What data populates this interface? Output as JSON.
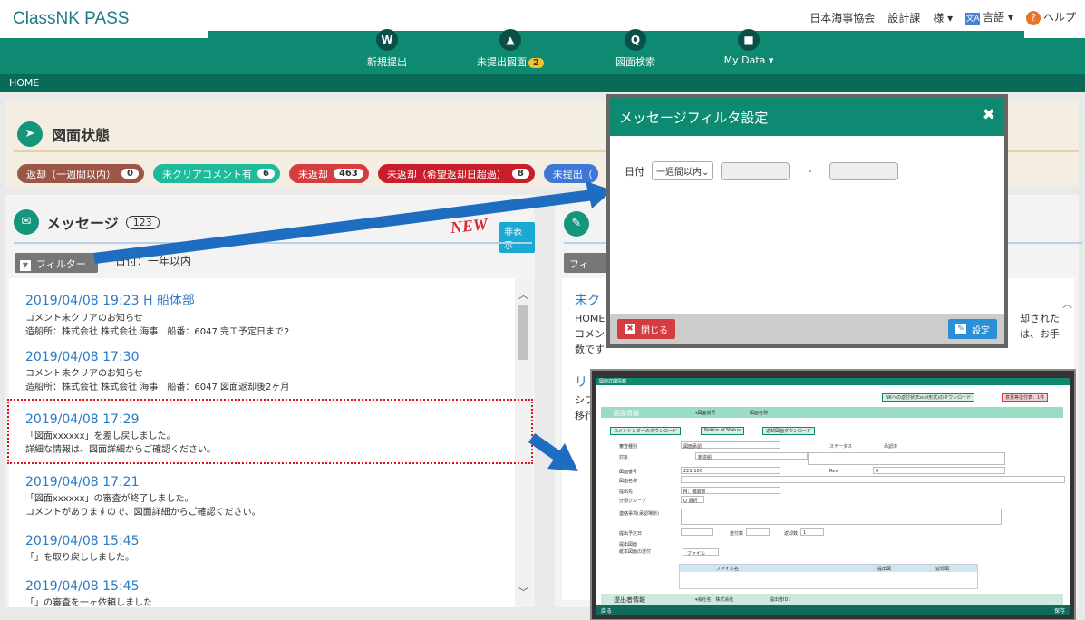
{
  "app": {
    "title": "ClassNK PASS"
  },
  "user_nav": {
    "org": "日本海事協会",
    "dept": "設計課",
    "honorific": "様 ▾",
    "lang": "言語 ▾",
    "lang_icon": "文A",
    "help": "ヘルプ",
    "help_icon": "?"
  },
  "nav": [
    {
      "label": "新規提出",
      "icon": "W"
    },
    {
      "label": "未提出図面",
      "badge": "2",
      "icon": "▲"
    },
    {
      "label": "図面検索",
      "icon": "Q"
    },
    {
      "label": "My Data ▾",
      "icon": "■"
    }
  ],
  "breadcrumb": "HOME",
  "status": {
    "title": "図面状態",
    "pills": [
      {
        "label": "返却（一週間以内）",
        "count": "0"
      },
      {
        "label": "未クリアコメント有",
        "count": "6"
      },
      {
        "label": "未返却",
        "count": "463"
      },
      {
        "label": "未返却（希望返却日超過）",
        "count": "8"
      },
      {
        "label": "未提出（",
        "count": ""
      }
    ]
  },
  "messages": {
    "title": "メッセージ",
    "count": "123",
    "new_badge": "NEW",
    "hide": "非表示",
    "filter": "フィルター",
    "filter_date": "日付：一年以内",
    "items": [
      {
        "date": "2019/04/08 19:23 H 船体部",
        "line1": "コメント未クリアのお知らせ",
        "line2": "造船所：株式会社 株式会社 海事　船番：6047 完工予定日まで2"
      },
      {
        "date": "2019/04/08 17:30",
        "line1": "コメント未クリアのお知らせ",
        "line2": "造船所：株式会社 株式会社 海事　船番：6047 図面返却後2ヶ月"
      },
      {
        "date": "2019/04/08 17:29",
        "line1": "「図面xxxxxx」を差し戻しました。",
        "line2": "詳細な情報は、図面詳細からご確認ください。"
      },
      {
        "date": "2019/04/08 17:21",
        "line1": "「図面xxxxxx」の審査が終了しました。",
        "line2": "コメントがありますので、図面詳細からご確認ください。"
      },
      {
        "date": "2019/04/08 15:45",
        "line1": "「」を取り戻ししました。",
        "line2": ""
      },
      {
        "date": "2019/04/08 15:45",
        "line1": "「」の審査を一ヶ依頼しました",
        "line2": ""
      }
    ]
  },
  "right": {
    "filter": "フィ",
    "t1": "未ク",
    "tx1a": "HOME",
    "tx1b": "コメン",
    "tx1c": "数です",
    "tx1r1": "却された",
    "tx1r2": "は、お手",
    "t2": "リ",
    "tx2a": "シフ",
    "tx2b": "移行"
  },
  "modal": {
    "title": "メッセージフィルタ設定",
    "close_icon": "✖",
    "date_label": "日付",
    "date_select": "一週間以内⌄",
    "dash": "-",
    "close_btn": "閉じる",
    "set_btn": "設定"
  },
  "thumb": {
    "title": "図面詳細情報",
    "dl1": "NKへの返付状(Excel形式)のダウンロード",
    "dl2": "意見等送付表：1件",
    "sec1": "図面情報",
    "drawing_no": "▾図面番号",
    "drawing_name": "図面名称",
    "btn1": "コメントレターのダウンロード",
    "btn2": "Notice of Status",
    "btn3": "返却図面ダウンロード",
    "l_kind": "審査種別",
    "v_kind": "図面承認",
    "l_status": "ステータス",
    "v_status": "承認済",
    "l_target": "対象",
    "v_target": "新造船",
    "l_no": "図面番号",
    "v_no": "221-100",
    "l_rev": "Rev",
    "v_rev": "0",
    "l_name": "図面名称",
    "l_sub": "提出先",
    "v_sub": "M：機関部",
    "l_group": "分類グループ",
    "v_group": "Q 選択",
    "l_note": "連絡事項(承認場所)",
    "l_plan": "提出予定日",
    "l_cnt": "送付数",
    "l_ret": "返却数",
    "v_ret": "1",
    "l_drw": "提出図面",
    "l_chk": "紙本図面の送付",
    "file_btn": "ファイル",
    "col1": "ファイル名",
    "col2": "提出図",
    "col3": "返却図",
    "sec2": "提出者情報",
    "company": "▾会社名：株式会社",
    "submitter": "提出者ID：",
    "back": "戻る",
    "save": "保存"
  },
  "colors": {
    "brand_green": "#0f8a72",
    "link_blue": "#2a7bc5",
    "arrow_blue": "#1f6dc0"
  }
}
